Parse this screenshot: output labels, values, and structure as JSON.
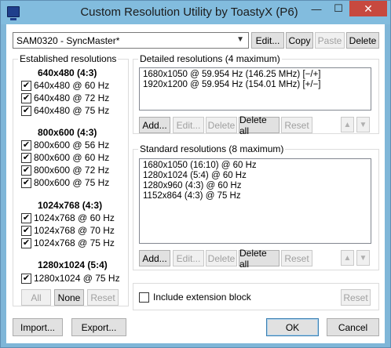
{
  "window": {
    "title": "Custom Resolution Utility by ToastyX (P6)",
    "minimize_glyph": "—",
    "maximize_glyph": "☐",
    "close_glyph": "✕"
  },
  "top_bar": {
    "monitor": "SAM0320 - SyncMaster*",
    "edit": "Edit...",
    "copy": "Copy",
    "paste": "Paste",
    "delete": "Delete"
  },
  "established": {
    "label": "Established resolutions",
    "groups": [
      {
        "heading": "640x480 (4:3)",
        "items": [
          "640x480 @ 60 Hz",
          "640x480 @ 72 Hz",
          "640x480 @ 75 Hz"
        ]
      },
      {
        "heading": "800x600 (4:3)",
        "items": [
          "800x600 @ 56 Hz",
          "800x600 @ 60 Hz",
          "800x600 @ 72 Hz",
          "800x600 @ 75 Hz"
        ]
      },
      {
        "heading": "1024x768 (4:3)",
        "items": [
          "1024x768 @ 60 Hz",
          "1024x768 @ 70 Hz",
          "1024x768 @ 75 Hz"
        ]
      },
      {
        "heading": "1280x1024 (5:4)",
        "items": [
          "1280x1024 @ 75 Hz"
        ]
      }
    ],
    "all": "All",
    "none": "None",
    "reset": "Reset"
  },
  "detailed": {
    "label": "Detailed resolutions (4 maximum)",
    "lines": [
      "1680x1050 @ 59.954 Hz (146.25 MHz) [−/+]",
      "1920x1200 @ 59.954 Hz (154.01 MHz) [+/−]"
    ],
    "add": "Add...",
    "edit": "Edit...",
    "delete": "Delete",
    "delete_all": "Delete all",
    "reset": "Reset"
  },
  "standard": {
    "label": "Standard resolutions (8 maximum)",
    "lines": [
      "1680x1050 (16:10) @ 60 Hz",
      "1280x1024 (5:4) @ 60 Hz",
      "1280x960 (4:3) @ 60 Hz",
      "1152x864 (4:3) @ 75 Hz"
    ],
    "add": "Add...",
    "edit": "Edit...",
    "delete": "Delete",
    "delete_all": "Delete all",
    "reset": "Reset"
  },
  "extension": {
    "label": "Include extension block",
    "reset": "Reset"
  },
  "bottom": {
    "import": "Import...",
    "export": "Export...",
    "ok": "OK",
    "cancel": "Cancel"
  },
  "arrows": {
    "up": "▲",
    "down": "▼"
  },
  "check_glyph": "✔"
}
